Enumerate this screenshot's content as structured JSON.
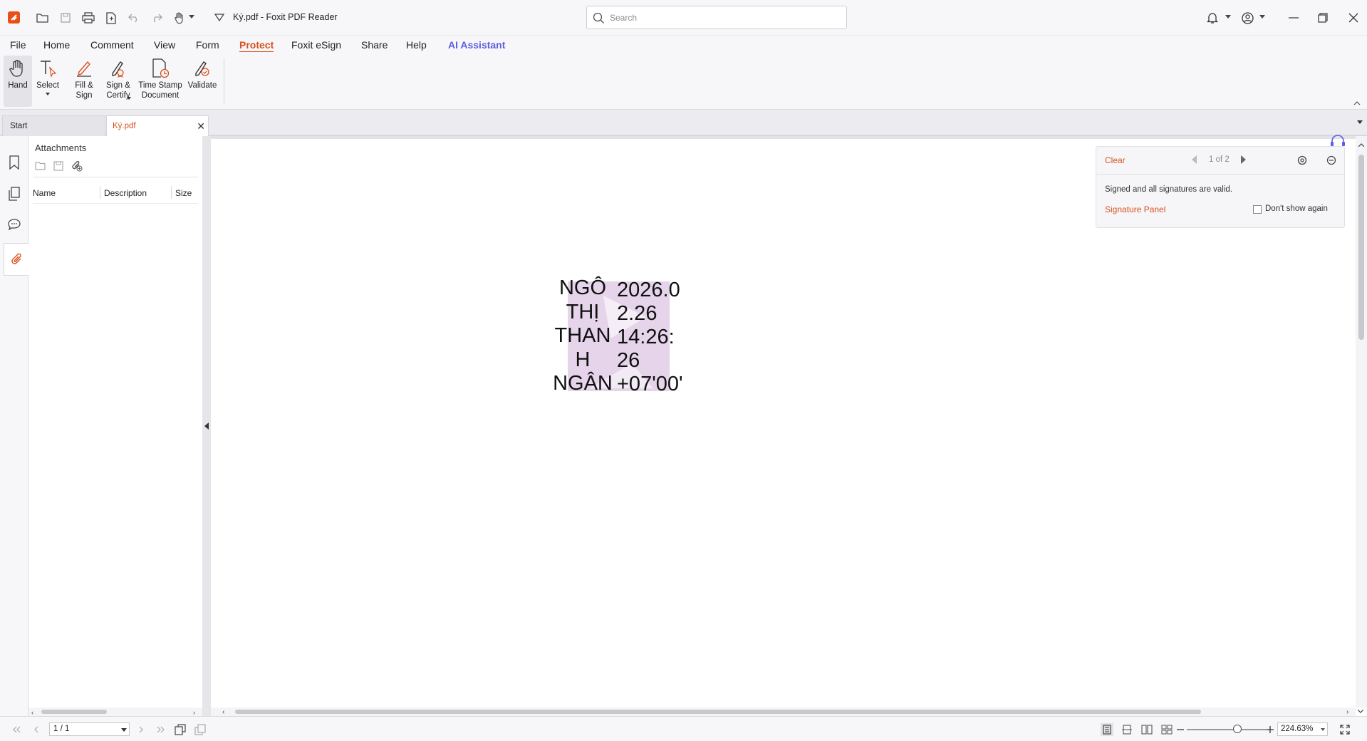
{
  "window": {
    "title": "Ký.pdf - Foxit PDF Reader",
    "search_placeholder": "Search"
  },
  "menu": {
    "items": [
      {
        "label": "File"
      },
      {
        "label": "Home"
      },
      {
        "label": "Comment"
      },
      {
        "label": "View"
      },
      {
        "label": "Form"
      },
      {
        "label": "Protect",
        "active": true
      },
      {
        "label": "Foxit eSign"
      },
      {
        "label": "Share"
      },
      {
        "label": "Help"
      },
      {
        "label": "AI Assistant"
      }
    ]
  },
  "ribbon": {
    "hand": {
      "line1": "Hand"
    },
    "select": {
      "line1": "Select"
    },
    "fill_sign": {
      "line1": "Fill &",
      "line2": "Sign"
    },
    "sign_certify": {
      "line1": "Sign &",
      "line2": "Certify"
    },
    "timestamp": {
      "line1": "Time Stamp",
      "line2": "Document"
    },
    "validate": {
      "line1": "Validate"
    }
  },
  "tabs": [
    {
      "label": "Start"
    },
    {
      "label": "Ký.pdf",
      "active": true
    }
  ],
  "attachments_panel": {
    "title": "Attachments",
    "columns": [
      "Name",
      "Description",
      "Size"
    ]
  },
  "signature_field": {
    "name_lines": [
      "NGÔ",
      "THỊ",
      "THAN",
      "H",
      "NGÂN"
    ],
    "date_lines": [
      "2026.0",
      "2.26",
      "14:26:",
      "26",
      "+07'00'"
    ]
  },
  "signature_notice": {
    "clear_label": "Clear",
    "page_of": "1 of 2",
    "message": "Signed and all signatures are valid.",
    "panel_link": "Signature Panel",
    "dont_show_label": "Don't show again"
  },
  "status": {
    "page": "1 / 1",
    "zoom": "224.63%"
  },
  "colors": {
    "accent": "#d94f1e",
    "ai": "#5a5fe0",
    "stamp": "#dcc6e3"
  }
}
